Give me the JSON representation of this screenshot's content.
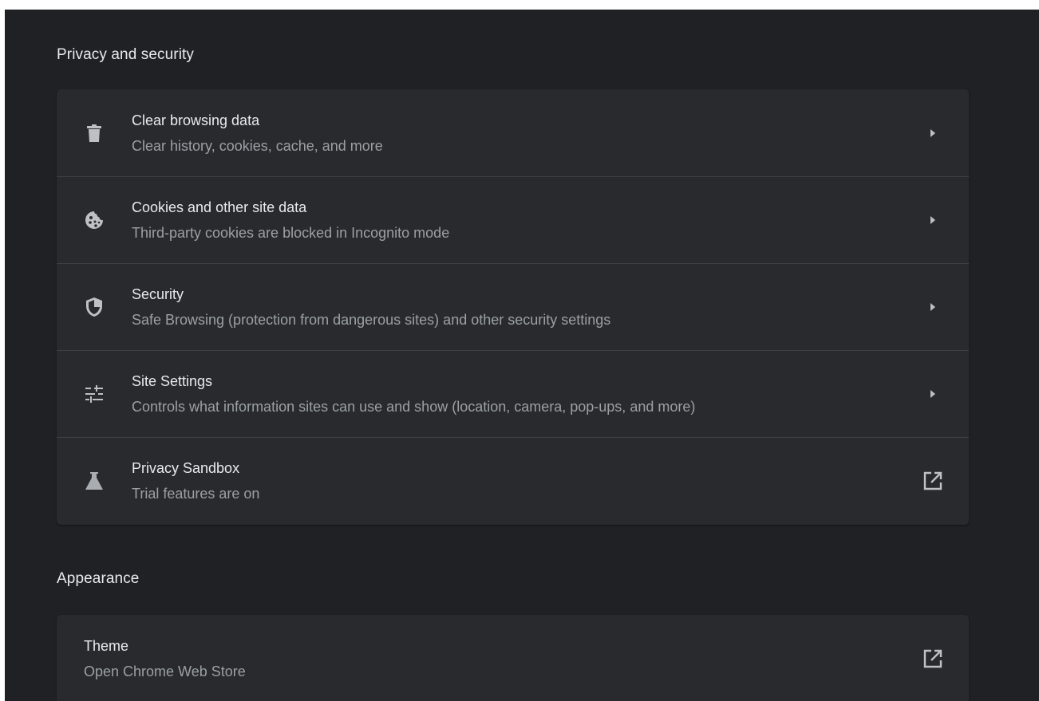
{
  "sections": {
    "privacy": {
      "title": "Privacy and security",
      "items": [
        {
          "title": "Clear browsing data",
          "subtitle": "Clear history, cookies, cache, and more",
          "icon": "trash-icon",
          "action_icon": "arrow-right-icon"
        },
        {
          "title": "Cookies and other site data",
          "subtitle": "Third-party cookies are blocked in Incognito mode",
          "icon": "cookie-icon",
          "action_icon": "arrow-right-icon"
        },
        {
          "title": "Security",
          "subtitle": "Safe Browsing (protection from dangerous sites) and other security settings",
          "icon": "shield-icon",
          "action_icon": "arrow-right-icon"
        },
        {
          "title": "Site Settings",
          "subtitle": "Controls what information sites can use and show (location, camera, pop-ups, and more)",
          "icon": "tune-icon",
          "action_icon": "arrow-right-icon"
        },
        {
          "title": "Privacy Sandbox",
          "subtitle": "Trial features are on",
          "icon": "flask-icon",
          "action_icon": "external-link-icon"
        }
      ]
    },
    "appearance": {
      "title": "Appearance",
      "items": [
        {
          "title": "Theme",
          "subtitle": "Open Chrome Web Store",
          "action_icon": "external-link-icon"
        }
      ]
    }
  },
  "colors": {
    "page_background": "#202124",
    "card_background": "#292a2d",
    "divider": "#3f4042",
    "primary_text": "#e8eaed",
    "secondary_text": "#9aa0a6",
    "icon": "#bdc1c6"
  }
}
